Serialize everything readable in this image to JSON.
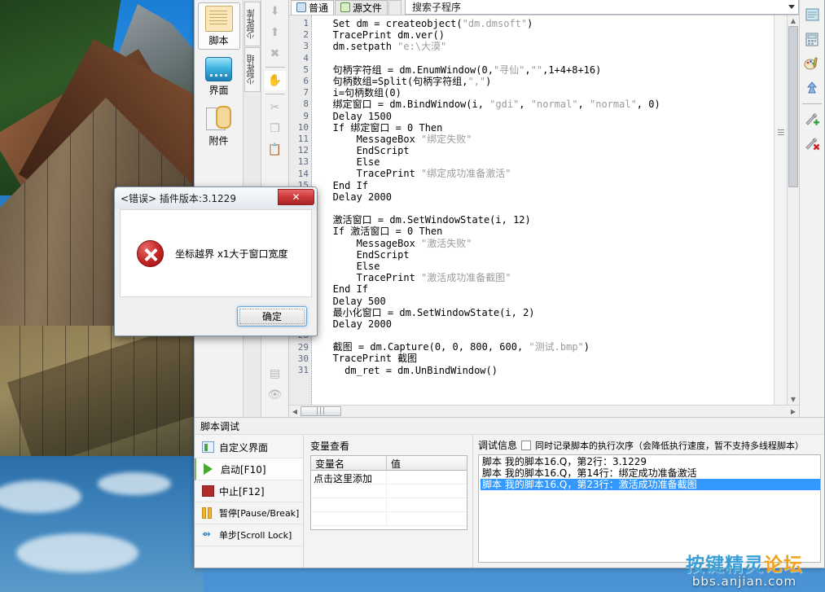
{
  "desktop": {
    "wallpaper_alt": "wooden-boathouse-lake-mountains"
  },
  "left_tools": [
    {
      "label": "脚本",
      "icon": "script-icon",
      "selected": true
    },
    {
      "label": "界面",
      "icon": "ui-icon",
      "selected": false
    },
    {
      "label": "附件",
      "icon": "attachment-icon",
      "selected": false
    }
  ],
  "vertical_tabs": [
    {
      "label": "少部件库"
    },
    {
      "label": "少部件组"
    }
  ],
  "vertical_toolbar": [
    {
      "icon": "arrow-down-icon",
      "name": "move-down"
    },
    {
      "icon": "arrow-up-icon",
      "name": "move-up"
    },
    {
      "icon": "delete-x-icon",
      "name": "delete"
    },
    {
      "icon": "hand-icon",
      "name": "pan",
      "active": true
    },
    {
      "icon": "scissors-icon",
      "name": "cut"
    },
    {
      "icon": "copy-icon",
      "name": "copy"
    },
    {
      "icon": "paste-icon",
      "name": "paste"
    },
    {
      "icon": "list-icon",
      "name": "properties"
    },
    {
      "icon": "eye-icon",
      "name": "preview"
    }
  ],
  "editor": {
    "tabs": [
      {
        "label": "普通",
        "icon": "normal-view-icon",
        "active": true
      },
      {
        "label": "源文件",
        "icon": "source-file-icon",
        "active": false
      }
    ],
    "search": {
      "value": "搜索子程序",
      "placeholder": "搜索子程序"
    },
    "hscroll_grip": "|||",
    "line_count": 31,
    "lines": [
      "   Set dm = createobject(\"dm.dmsoft\")",
      "   TracePrint dm.ver()",
      "   dm.setpath \"e:\\大漠\"",
      "",
      "   句柄字符组 = dm.EnumWindow(0,\"寻仙\",\"\",1+4+8+16)",
      "   句柄数组=Split(句柄字符组,\",\")",
      "   i=句柄数组(0)",
      "   绑定窗口 = dm.BindWindow(i, \"gdi\", \"normal\", \"normal\", 0)",
      "   Delay 1500",
      "   If 绑定窗口 = 0 Then",
      "       MessageBox \"绑定失败\"",
      "       EndScript",
      "       Else",
      "       TracePrint \"绑定成功准备激活\"",
      "   End If",
      "   Delay 2000",
      "",
      "   激活窗口 = dm.SetWindowState(i, 12)",
      "   If 激活窗口 = 0 Then",
      "       MessageBox \"激活失败\"",
      "       EndScript",
      "       Else",
      "       TracePrint \"激活成功准备截图\"",
      "   End If",
      "   Delay 500",
      "   最小化窗口 = dm.SetWindowState(i, 2)",
      "   Delay 2000",
      "",
      "   截图 = dm.Capture(0, 0, 800, 600, \"测试.bmp\")",
      "   TracePrint 截图",
      "     dm_ret = dm.UnBindWindow()"
    ]
  },
  "right_tools": [
    {
      "icon": "notepad-icon",
      "name": "notepad"
    },
    {
      "icon": "calculator-icon",
      "name": "calculator"
    },
    {
      "icon": "color-picker-icon",
      "name": "color-picker"
    },
    {
      "icon": "capture-icon",
      "name": "screen-capture"
    },
    {
      "icon": "wrench-add-icon",
      "name": "add-plugin"
    },
    {
      "icon": "wrench-remove-icon",
      "name": "remove-plugin"
    }
  ],
  "debug": {
    "title": "脚本调试",
    "actions": [
      {
        "label": "自定义界面",
        "icon": "custom-ui-icon"
      },
      {
        "label": "启动[F10]",
        "icon": "play-icon",
        "highlight": true
      },
      {
        "label": "中止[F12]",
        "icon": "stop-icon"
      },
      {
        "label": "暂停[Pause/Break]",
        "icon": "pause-icon"
      },
      {
        "label": "单步[Scroll Lock]",
        "icon": "step-icon"
      }
    ],
    "variables": {
      "title": "变量查看",
      "columns": [
        "变量名",
        "值"
      ],
      "rows": [
        {
          "name": "点击这里添加",
          "value": ""
        }
      ],
      "empty_rows": 4
    },
    "info": {
      "title": "调试信息",
      "checkbox_label": "同时记录脚本的执行次序（会降低执行速度，暂不支持多线程脚本）",
      "checked": false,
      "lines": [
        {
          "text": "脚本 我的脚本16.Q，第2行：3.1229",
          "selected": false
        },
        {
          "text": "脚本 我的脚本16.Q，第14行：绑定成功准备激活",
          "selected": false
        },
        {
          "text": "脚本 我的脚本16.Q，第23行：激活成功准备截图",
          "selected": true
        }
      ]
    }
  },
  "dialog": {
    "title": "<错误> 插件版本:3.1229",
    "close_label": "✕",
    "message": "坐标越界 x1大于窗口宽度",
    "ok_label": "确定",
    "icon": "error-x-icon"
  },
  "watermark": {
    "line1_a": "按键精灵",
    "line1_b": "论坛",
    "line2": "bbs.anjian.com"
  },
  "colors": {
    "accent_blue": "#3399ff",
    "error_red": "#c42222",
    "window_bg": "#f0f0f0",
    "editor_bg": "#ffffff"
  }
}
